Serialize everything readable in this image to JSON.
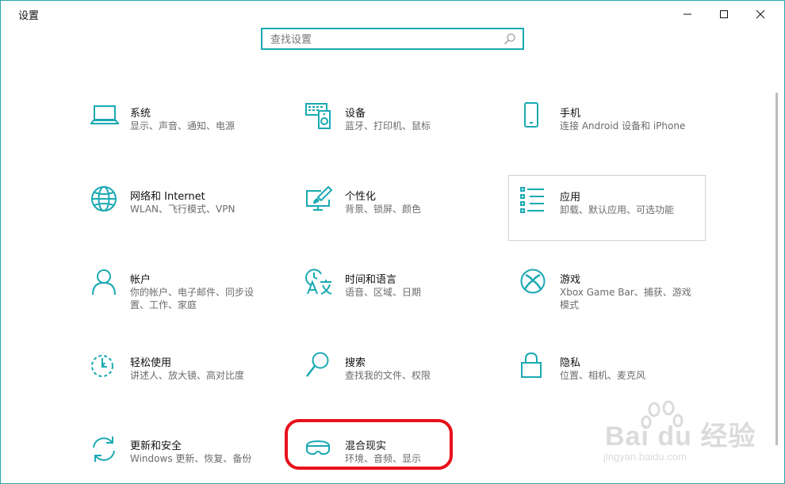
{
  "window": {
    "title": "设置"
  },
  "search": {
    "placeholder": "查找设置"
  },
  "colors": {
    "accent": "#1aa9b3",
    "highlight": "#e8101a"
  },
  "tiles": [
    {
      "name": "系统",
      "desc": "显示、声音、通知、电源",
      "icon": "laptop-icon"
    },
    {
      "name": "设备",
      "desc": "蓝牙、打印机、鼠标",
      "icon": "keyboard-speaker-icon"
    },
    {
      "name": "手机",
      "desc": "连接 Android 设备和 iPhone",
      "icon": "phone-icon"
    },
    {
      "name": "网络和 Internet",
      "desc": "WLAN、飞行模式、VPN",
      "icon": "globe-icon"
    },
    {
      "name": "个性化",
      "desc": "背景、锁屏、颜色",
      "icon": "paint-icon"
    },
    {
      "name": "应用",
      "desc": "卸载、默认应用、可选功能",
      "icon": "apps-list-icon"
    },
    {
      "name": "帐户",
      "desc": "你的帐户、电子邮件、同步设置、工作、家庭",
      "icon": "person-icon"
    },
    {
      "name": "时间和语言",
      "desc": "语音、区域、日期",
      "icon": "time-language-icon"
    },
    {
      "name": "游戏",
      "desc": "Xbox Game Bar、捕获、游戏模式",
      "icon": "xbox-icon"
    },
    {
      "name": "轻松使用",
      "desc": "讲述人、放大镜、高对比度",
      "icon": "ease-of-access-icon"
    },
    {
      "name": "搜索",
      "desc": "查找我的文件、权限",
      "icon": "magnifier-icon"
    },
    {
      "name": "隐私",
      "desc": "位置、相机、麦克风",
      "icon": "lock-icon"
    },
    {
      "name": "更新和安全",
      "desc": "Windows 更新、恢复、备份",
      "icon": "sync-icon"
    },
    {
      "name": "混合现实",
      "desc": "环境、音频、显示",
      "icon": "headset-icon"
    }
  ],
  "watermark": {
    "line1": "Bai du 经验",
    "line2": "jingyan.baidu.com"
  }
}
